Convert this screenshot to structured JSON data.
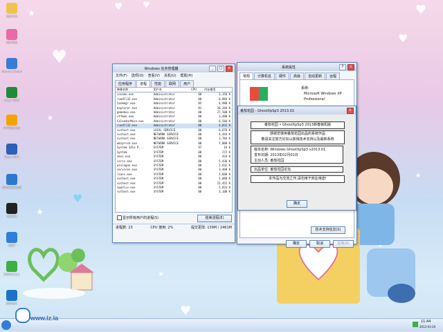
{
  "desktop": {
    "icons": [
      {
        "label": "我的文档",
        "color": "#f0c44c",
        "icon": "documents-icon"
      },
      {
        "label": "我的电脑",
        "color": "#e86aa6",
        "icon": "computer-icon"
      },
      {
        "label": "Internet Explorer",
        "color": "#3a7bd5",
        "icon": "ie-icon"
      },
      {
        "label": "Excel 2003",
        "color": "#1e8b3a",
        "icon": "excel-icon"
      },
      {
        "label": "PPS网络电视",
        "color": "#f2a400",
        "icon": "pps-icon"
      },
      {
        "label": "Word 2003",
        "color": "#2b5fb8",
        "icon": "word-icon"
      },
      {
        "label": "搜狗高速浏览器",
        "color": "#2b78d0",
        "icon": "sogou-icon"
      },
      {
        "label": "腾讯QQ",
        "color": "#222222",
        "icon": "qq-icon"
      },
      {
        "label": "迅雷7",
        "color": "#2f7fd8",
        "icon": "thunder-icon"
      },
      {
        "label": "360安全卫士",
        "color": "#3cb043",
        "icon": "360-icon"
      },
      {
        "label": "酷狗音乐",
        "color": "#1a73c8",
        "icon": "kugou-icon"
      }
    ]
  },
  "taskmgr": {
    "title": "Windows 任务管理器",
    "menu": [
      "文件(F)",
      "选项(O)",
      "查看(V)",
      "关机(U)",
      "帮助(H)"
    ],
    "tabs": [
      "应用程序",
      "进程",
      "性能",
      "联网",
      "用户"
    ],
    "columns": [
      "映像名称",
      "用户名",
      "CPU",
      "内存使用"
    ],
    "rows": [
      [
        "conime.exe",
        "Administrator",
        "00",
        "3,156 K"
      ],
      [
        "rundll32.exe",
        "Administrator",
        "00",
        "6,884 K"
      ],
      [
        "taskmgr.exe",
        "Administrator",
        "02",
        "4,980 K"
      ],
      [
        "explorer.exe",
        "Administrator",
        "01",
        "18,284 K"
      ],
      [
        "gamebox.exe",
        "Administrator",
        "00",
        "27,500 K"
      ],
      [
        "ctfmon.exe",
        "Administrator",
        "00",
        "3,480 K"
      ],
      [
        "CalendarMain.exe",
        "Administrator",
        "00",
        "6,584 K"
      ],
      [
        "rundll32.exe",
        "Administrator",
        "00",
        "4,032 K"
      ],
      [
        "svchost.exe",
        "LOCAL SERVICE",
        "00",
        "6,676 K"
      ],
      [
        "svchost.exe",
        "NETWORK SERVICE",
        "00",
        "4,444 K"
      ],
      [
        "svchost.exe",
        "NETWORK SERVICE",
        "00",
        "3,784 K"
      ],
      [
        "wmiprvse.exe",
        "NETWORK SERVICE",
        "00",
        "7,000 K"
      ],
      [
        "System Idle P...",
        "SYSTEM",
        "97",
        "16 K"
      ],
      [
        "System",
        "SYSTEM",
        "00",
        "272 K"
      ],
      [
        "smss.exe",
        "SYSTEM",
        "00",
        "424 K"
      ],
      [
        "csrss.exe",
        "SYSTEM",
        "00",
        "5,436 K"
      ],
      [
        "winlogon.exe",
        "SYSTEM",
        "00",
        "2,632 K"
      ],
      [
        "services.exe",
        "SYSTEM",
        "00",
        "3,468 K"
      ],
      [
        "lsass.exe",
        "SYSTEM",
        "00",
        "5,608 K"
      ],
      [
        "svchost.exe",
        "SYSTEM",
        "00",
        "5,088 K"
      ],
      [
        "svchost.exe",
        "SYSTEM",
        "00",
        "22,452 K"
      ],
      [
        "spoolsv.exe",
        "SYSTEM",
        "00",
        "5,824 K"
      ],
      [
        "svchost.exe",
        "SYSTEM",
        "00",
        "3,100 K"
      ]
    ],
    "selected_row": 7,
    "show_all_label": "显示所有用户的进程(S)",
    "end_process_label": "结束进程(E)",
    "status": {
      "processes": "进程数: 23",
      "cpu": "CPU 使用: 2%",
      "commit": "提交更改: 139M / 2461M"
    }
  },
  "sysprops": {
    "title": "系统属性",
    "tabs": [
      "常规",
      "计算机名",
      "硬件",
      "高级",
      "自动更新",
      "远程"
    ],
    "system_label": "系统:",
    "system_lines": [
      "Microsoft Windows XP",
      "Professional"
    ],
    "ok_label": "确定",
    "cancel_label": "取消",
    "apply_label": "应用(A)",
    "support_label": "技术支持信息(S)"
  },
  "popup": {
    "title": "番茄花园 - GhostXpSp3 2013.02",
    "headline": "番茄花园 • GhostXpSp3 2013新春装机版",
    "thanks": [
      "感谢您使用番茄花园出品的系统作品",
      "敬请关注官方论坛以获得技术支持以及最新系统"
    ],
    "info": [
      "版本名称: Windows GhostXpSp3 v2013.01",
      "发布日期: 2013年02月01日",
      "主创人员: 番茄花园"
    ],
    "org": "出品单位: 番茄花园论坛",
    "notice": "本作品为交流之作,请勿用于商业用途!",
    "ok_label": "确定"
  },
  "taskbar": {
    "watermark": "www.lz.la",
    "time": "11:44",
    "date": "2013-03-20"
  },
  "colors": {
    "title_accent": "#5d87b8",
    "selection": "#cfe0f5"
  }
}
